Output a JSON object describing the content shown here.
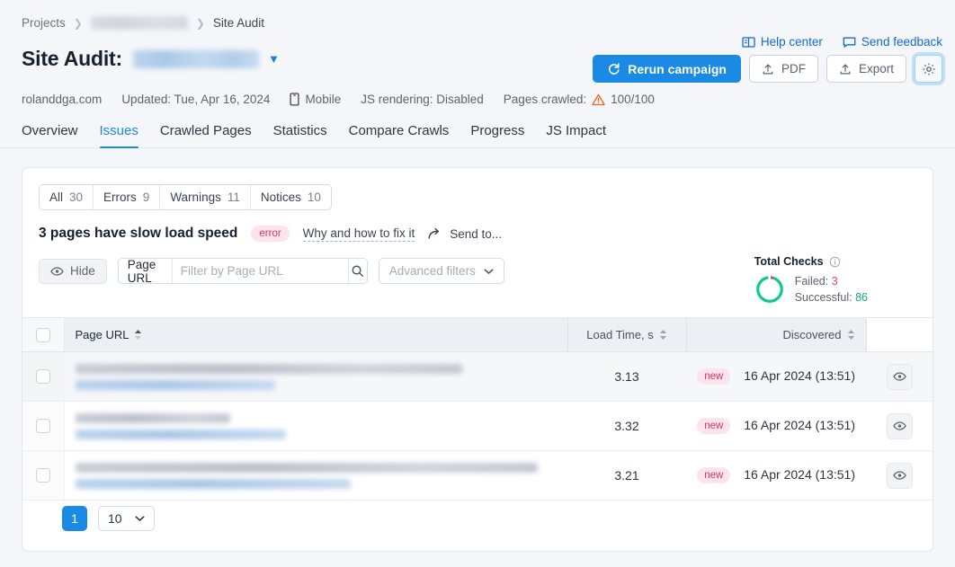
{
  "breadcrumb": {
    "projects": "Projects",
    "project_redacted": "",
    "current": "Site Audit"
  },
  "header": {
    "title_label": "Site Audit:",
    "project_name_redacted": "",
    "help_center": "Help center",
    "send_feedback": "Send feedback",
    "rerun_campaign": "Rerun campaign",
    "pdf": "PDF",
    "export": "Export"
  },
  "meta": {
    "domain": "rolanddga.com",
    "updated": "Updated: Tue, Apr 16, 2024",
    "device": "Mobile",
    "js_rendering": "JS rendering: Disabled",
    "pages_crawled_label": "Pages crawled:",
    "pages_crawled_value": "100/100"
  },
  "tabs": [
    {
      "label": "Overview",
      "active": false
    },
    {
      "label": "Issues",
      "active": true
    },
    {
      "label": "Crawled Pages",
      "active": false
    },
    {
      "label": "Statistics",
      "active": false
    },
    {
      "label": "Compare Crawls",
      "active": false
    },
    {
      "label": "Progress",
      "active": false
    },
    {
      "label": "JS Impact",
      "active": false
    }
  ],
  "segments": [
    {
      "label": "All",
      "count": "30"
    },
    {
      "label": "Errors",
      "count": "9"
    },
    {
      "label": "Warnings",
      "count": "11"
    },
    {
      "label": "Notices",
      "count": "10"
    }
  ],
  "issue": {
    "title": "3 pages have slow load speed",
    "badge": "error",
    "fix_link": "Why and how to fix it",
    "send_to": "Send to..."
  },
  "filters": {
    "hide": "Hide",
    "search_prefix": "Page URL",
    "search_placeholder": "Filter by Page URL",
    "search_value": "",
    "advanced": "Advanced filters"
  },
  "total_checks": {
    "title": "Total Checks",
    "failed_label": "Failed:",
    "failed_value": "3",
    "successful_label": "Successful:",
    "successful_value": "86",
    "failed_color": "#e0436d",
    "successful_color": "#0fae7e"
  },
  "table": {
    "columns": [
      {
        "label": "Page URL",
        "sorted": true
      },
      {
        "label": "Load Time, s",
        "sorted": false
      },
      {
        "label": "Discovered",
        "sorted": false
      }
    ],
    "rows": [
      {
        "url_redacted": "",
        "load_time": "3.13",
        "badge": "new",
        "discovered": "16 Apr 2024 (13:51)",
        "highlight": true
      },
      {
        "url_redacted": "",
        "load_time": "3.32",
        "badge": "new",
        "discovered": "16 Apr 2024 (13:51)",
        "highlight": false
      },
      {
        "url_redacted": "",
        "load_time": "3.21",
        "badge": "new",
        "discovered": "16 Apr 2024 (13:51)",
        "highlight": false
      }
    ]
  },
  "pagination": {
    "current_page": "1",
    "per_page": "10"
  },
  "colors": {
    "accent": "#1a8ae5",
    "error": "#d2356a",
    "warning": "#ef6523",
    "success": "#0fae7e"
  }
}
